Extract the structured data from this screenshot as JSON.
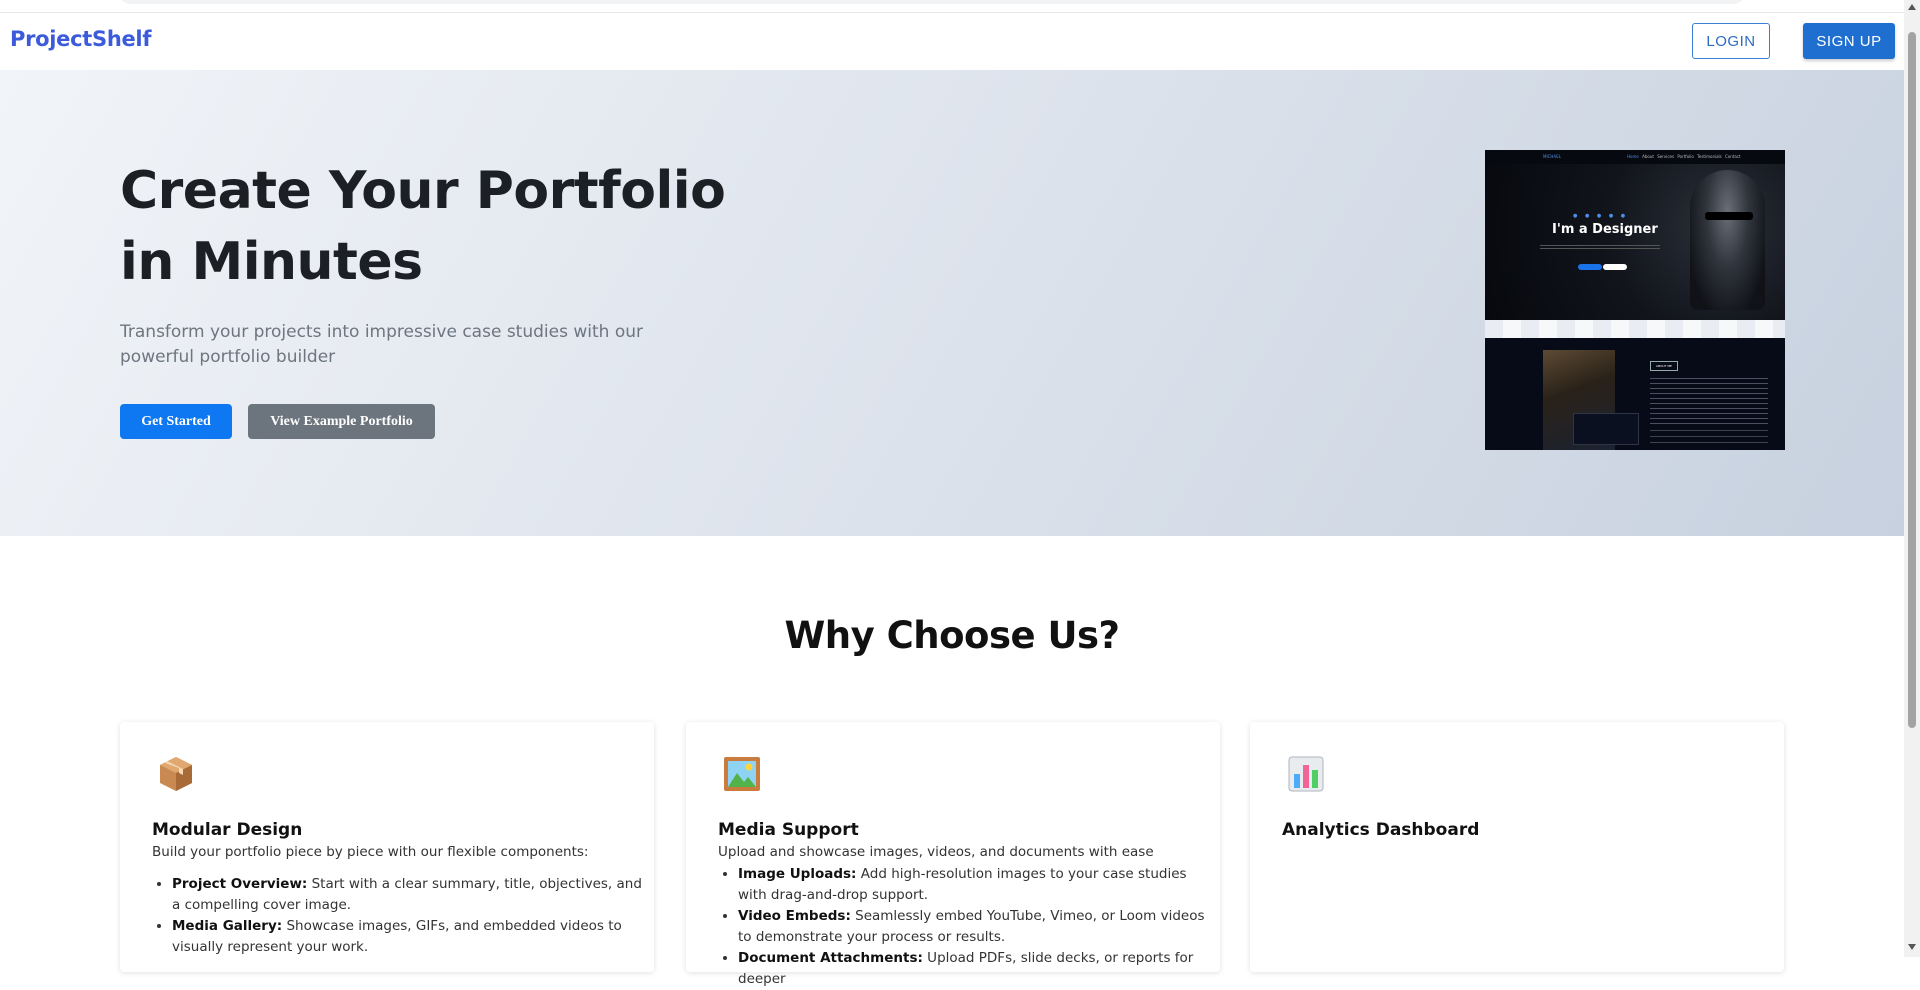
{
  "navbar": {
    "brand": "ProjectShelf",
    "login_label": "LOGIN",
    "signup_label": "SIGN UP"
  },
  "hero": {
    "title": "Create Your Portfolio in Minutes",
    "subtitle": "Transform your projects into impressive case studies with our powerful portfolio builder",
    "primary_button": "Get Started",
    "secondary_button": "View Example Portfolio",
    "preview": {
      "logo": "MICHAEL",
      "menu": [
        "Home",
        "About",
        "Services",
        "Portfolio",
        "Testimonials",
        "Contact"
      ],
      "heading": "I'm a Designer",
      "about_label": "ABOUT ME"
    }
  },
  "why": {
    "title": "Why Choose Us?",
    "cards": [
      {
        "icon": "package-icon",
        "title": "Modular Design",
        "description": "Build your portfolio piece by piece with our flexible components:",
        "items": [
          {
            "term": "Project Overview:",
            "text": " Start with a clear summary, title, objectives, and a compelling cover image."
          },
          {
            "term": "Media Gallery:",
            "text": " Showcase images, GIFs, and embedded videos to visually represent your work."
          }
        ]
      },
      {
        "icon": "framed-picture-icon",
        "title": "Media Support",
        "description": "Upload and showcase images, videos, and documents with ease",
        "items": [
          {
            "term": "Image Uploads:",
            "text": " Add high-resolution images to your case studies with drag-and-drop support."
          },
          {
            "term": "Video Embeds:",
            "text": " Seamlessly embed YouTube, Vimeo, or Loom videos to demonstrate your process or results."
          },
          {
            "term": "Document Attachments:",
            "text": " Upload PDFs, slide decks, or reports for deeper"
          }
        ]
      },
      {
        "icon": "bar-chart-icon",
        "title": "Analytics Dashboard",
        "description": "",
        "items": []
      }
    ]
  }
}
